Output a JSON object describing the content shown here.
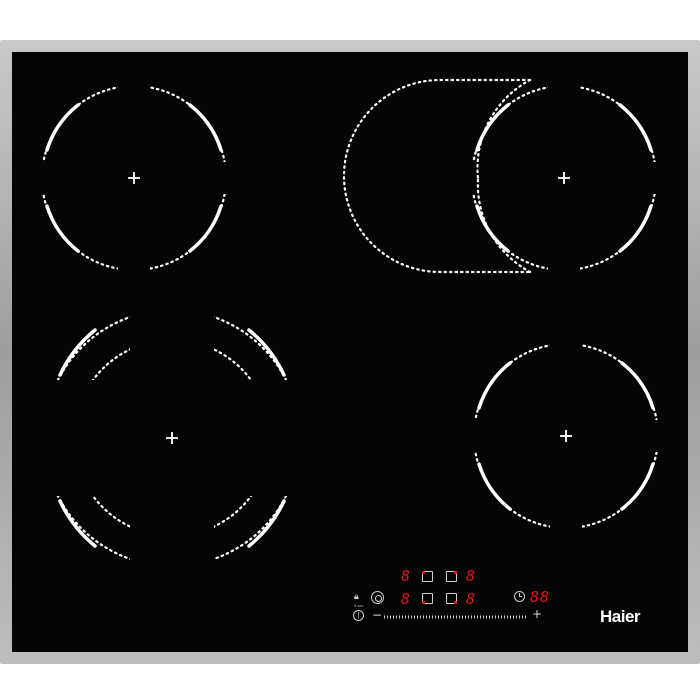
{
  "brand": {
    "name": "Haier"
  },
  "zones": [
    {
      "id": "front-left",
      "shape": "single"
    },
    {
      "id": "rear-left",
      "shape": "triple"
    },
    {
      "id": "rear-right",
      "shape": "oval-extended"
    },
    {
      "id": "front-right",
      "shape": "single"
    }
  ],
  "panel": {
    "zone_displays": [
      "8",
      "8",
      "8",
      "8"
    ],
    "timer_display": "88",
    "lock_caption": "3 sec",
    "minus": "−",
    "plus": "+"
  },
  "colors": {
    "glass": "#050505",
    "frame": "#b3b3b3",
    "display": "#e0161b",
    "markings": "#ffffff"
  },
  "icons": [
    "lock-icon",
    "power-icon",
    "bridge-icon",
    "clock-icon",
    "plus-icon",
    "minus-icon",
    "zone-indicator-icon"
  ]
}
